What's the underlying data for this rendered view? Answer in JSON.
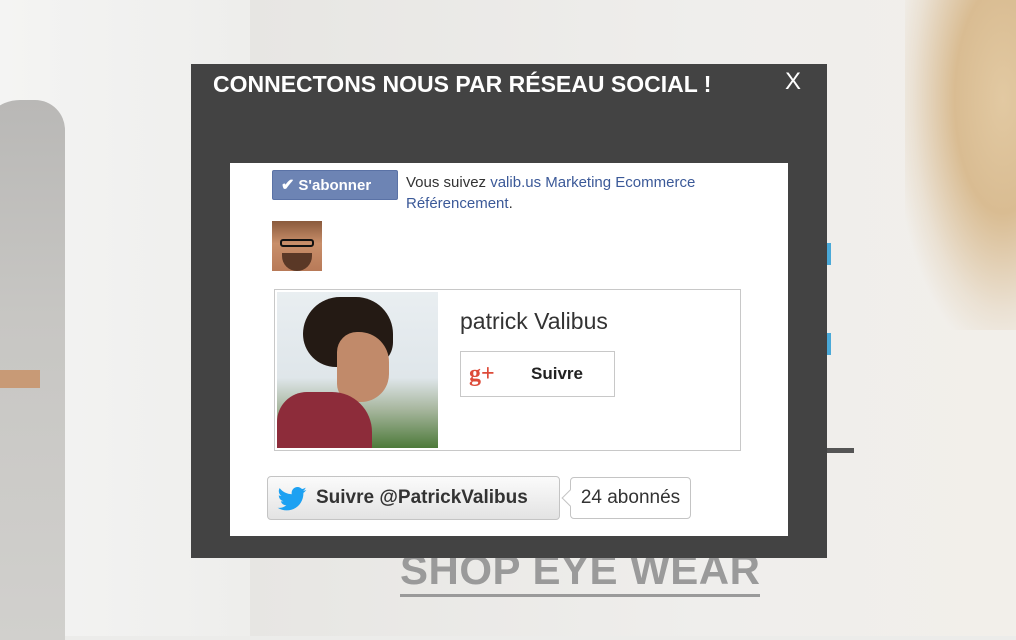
{
  "background": {
    "shop_link_label": "SHOP EYE WEAR"
  },
  "modal": {
    "title": "CONNECTONS NOUS PAR RÉSEAU SOCIAL !",
    "close_label": "X"
  },
  "facebook": {
    "subscribe_label": "S'abonner",
    "check_icon": "check-icon",
    "follow_text_prefix": "Vous suivez",
    "follow_link": "valib.us Marketing Ecommerce Référencement",
    "follow_text_suffix": "."
  },
  "google_plus": {
    "profile_name": "patrick Valibus",
    "icon_label": "g+",
    "follow_label": "Suivre"
  },
  "twitter": {
    "follow_label": "Suivre @PatrickValibus",
    "followers_count": "24 abonnés"
  },
  "colors": {
    "modal_bg": "#434343",
    "facebook_blue": "#6d84b4",
    "google_red": "#dd4b39",
    "twitter_blue": "#1da1f2"
  }
}
